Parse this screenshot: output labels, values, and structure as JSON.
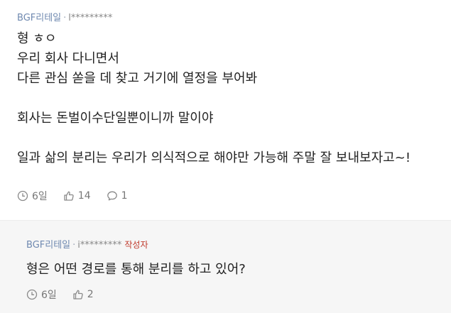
{
  "comment": {
    "company": "BGF리테일",
    "separator": "·",
    "user": "l*********",
    "lines": [
      "형 ㅎㅇ",
      "우리 회사 다니면서",
      "다른 관심 쏟을 데 찾고 거기에 열정을 부어봐",
      "",
      "회사는 돈벌이수단일뿐이니까 말이야",
      "",
      "일과 삶의 분리는 우리가 의식적으로 해야만 가능해 주말 잘 보내보자고~!"
    ],
    "time": "6일",
    "likes": "14",
    "replies": "1",
    "icons": [
      "clock-icon",
      "thumbs-up-icon",
      "speech-bubble-icon"
    ]
  },
  "reply": {
    "company": "BGF리테일",
    "separator": "·",
    "user": "i*********",
    "author_badge": "작성자",
    "lines": [
      "형은 어떤 경로를 통해 분리를 하고 있어?"
    ],
    "time": "6일",
    "likes": "2",
    "icons": [
      "clock-icon",
      "thumbs-up-icon"
    ]
  },
  "colors": {
    "company": "#6f89b0",
    "author_badge": "#c0392b",
    "reply_background": "#f6f6f6"
  }
}
